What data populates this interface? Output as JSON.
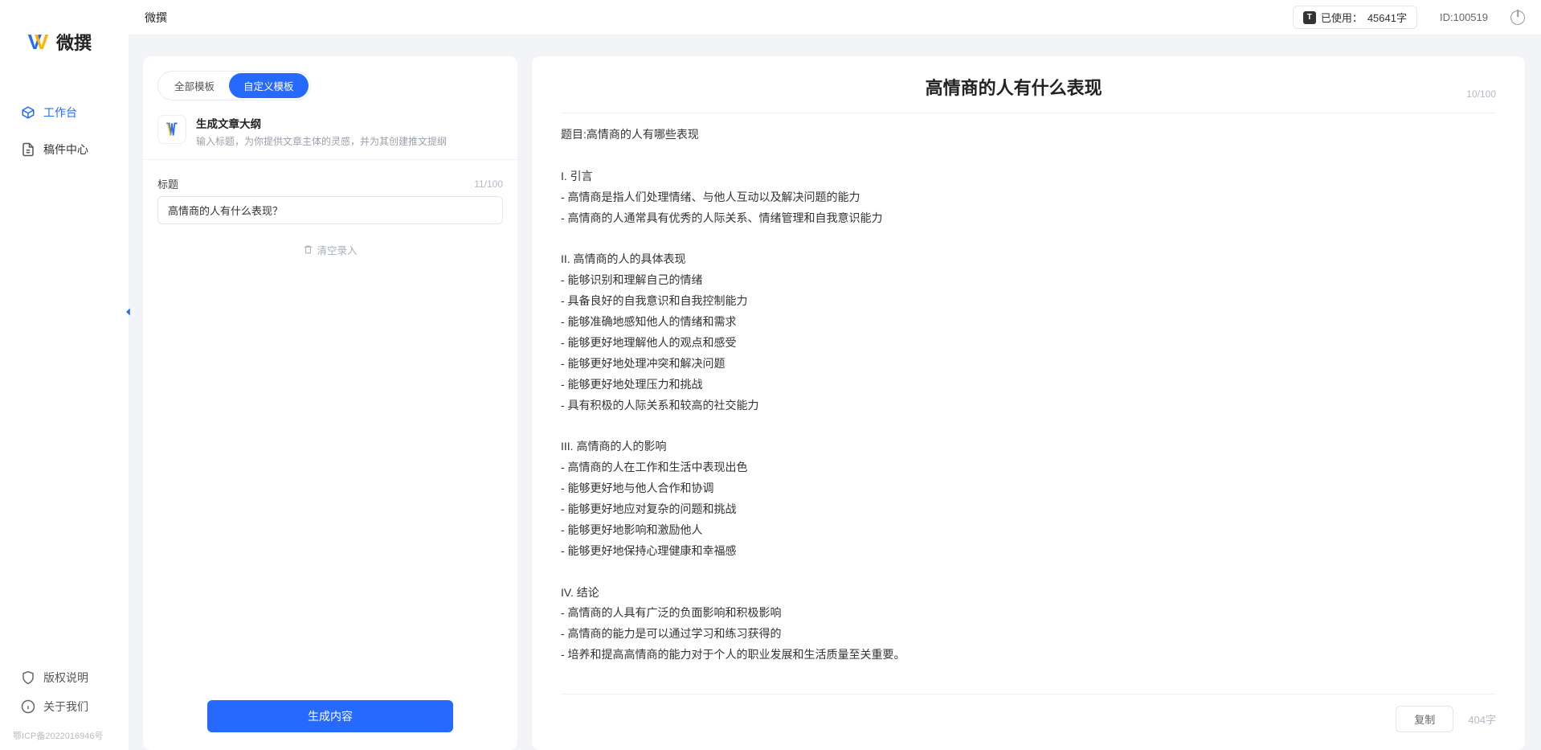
{
  "logo_text": "微撰",
  "header": {
    "app_title": "微撰",
    "usage_prefix": "已使用：",
    "usage_value": "45641字",
    "id_prefix": "ID:",
    "id_value": "100519"
  },
  "sidebar": {
    "items": [
      {
        "label": "工作台",
        "active": true
      },
      {
        "label": "稿件中心",
        "active": false
      }
    ],
    "bottom": [
      {
        "label": "版权说明"
      },
      {
        "label": "关于我们"
      }
    ],
    "icp": "鄂ICP备2022016946号"
  },
  "left": {
    "tabs": {
      "all": "全部模板",
      "custom": "自定义模板"
    },
    "template": {
      "title": "生成文章大纲",
      "desc": "输入标题，为你提供文章主体的灵感，并为其创建推文提纲"
    },
    "label": "标题",
    "input_value": "高情商的人有什么表现？",
    "input_counter": "11/100",
    "clear": "清空录入",
    "generate": "生成内容"
  },
  "right": {
    "title": "高情商的人有什么表现",
    "title_counter": "10/100",
    "body": "题目:高情商的人有哪些表现\n\nI. 引言\n- 高情商是指人们处理情绪、与他人互动以及解决问题的能力\n- 高情商的人通常具有优秀的人际关系、情绪管理和自我意识能力\n\nII. 高情商的人的具体表现\n- 能够识别和理解自己的情绪\n- 具备良好的自我意识和自我控制能力\n- 能够准确地感知他人的情绪和需求\n- 能够更好地理解他人的观点和感受\n- 能够更好地处理冲突和解决问题\n- 能够更好地处理压力和挑战\n- 具有积极的人际关系和较高的社交能力\n\nIII. 高情商的人的影响\n- 高情商的人在工作和生活中表现出色\n- 能够更好地与他人合作和协调\n- 能够更好地应对复杂的问题和挑战\n- 能够更好地影响和激励他人\n- 能够更好地保持心理健康和幸福感\n\nIV. 结论\n- 高情商的人具有广泛的负面影响和积极影响\n- 高情商的能力是可以通过学习和练习获得的\n- 培养和提高高情商的能力对于个人的职业发展和生活质量至关重要。",
    "copy": "复制",
    "word_count": "404字"
  }
}
